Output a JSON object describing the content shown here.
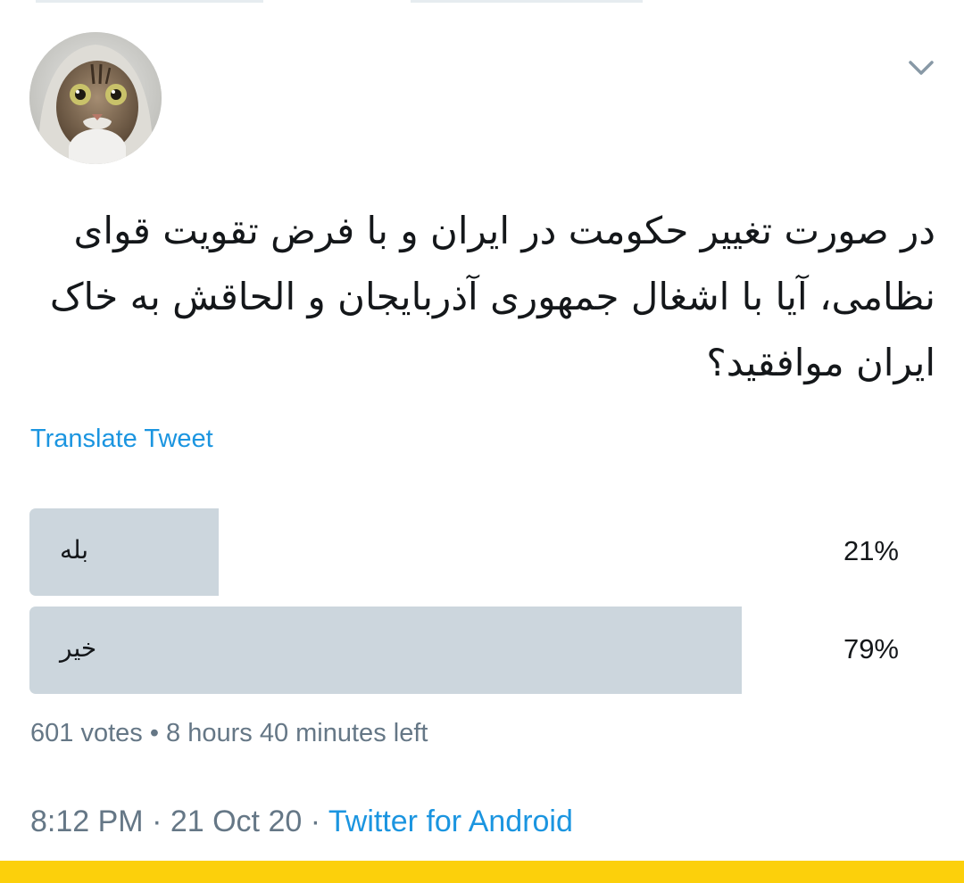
{
  "tweet": {
    "text": "در صورت تغییر حکومت در ایران و با فرض تقویت قوای نظامی، آیا با اشغال جمهوری آذربایجان و الحاقش به خاک ایران موافقید؟",
    "translate_label": "Translate Tweet",
    "timestamp": "8:12 PM · 21 Oct 20",
    "separator": " · ",
    "source": "Twitter for Android"
  },
  "poll": {
    "options": [
      {
        "label": "بله",
        "percent_text": "21%",
        "percent": 21
      },
      {
        "label": "خیر",
        "percent_text": "79%",
        "percent": 79
      }
    ],
    "votes": "601 votes",
    "dot": " • ",
    "time_left": "8 hours 40 minutes left"
  },
  "icons": {
    "menu": "chevron-down-icon",
    "avatar": "cat-avatar"
  },
  "colors": {
    "link": "#1b95e0",
    "poll_bar": "#ccd6dd",
    "muted_text": "#657786",
    "bottom_bar": "#fcd00b"
  }
}
